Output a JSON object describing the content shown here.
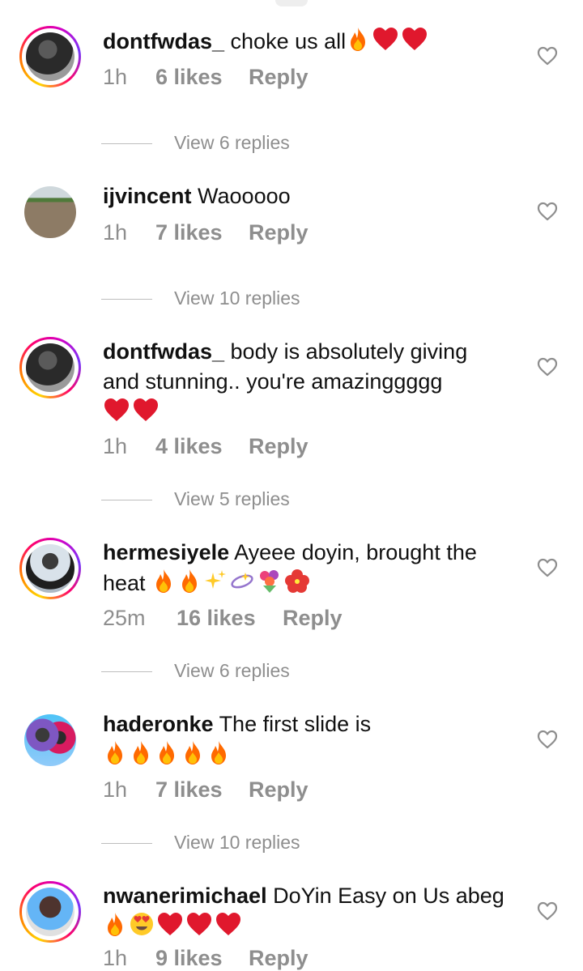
{
  "comments": [
    {
      "username": "dontfwdas_",
      "text": "choke us all",
      "emojis": [
        "fire",
        "heart",
        "heart"
      ],
      "time": "1h",
      "likes": "6 likes",
      "reply": "Reply"
    },
    {
      "username": "ijvincent",
      "text": "Waooooo",
      "emojis": [],
      "time": "1h",
      "likes": "7 likes",
      "reply": "Reply"
    },
    {
      "username": "dontfwdas_",
      "text": "body is absolutely giving and stunning.. you're amazinggggg",
      "emojis": [
        "heart",
        "heart"
      ],
      "time": "1h",
      "likes": "4 likes",
      "reply": "Reply"
    },
    {
      "username": "hermesiyele",
      "text": "Ayeee doyin, brought the heat",
      "emojis": [
        "fire",
        "fire",
        "sparkles",
        "dizzy",
        "bouquet",
        "hibiscus"
      ],
      "time": "25m",
      "likes": "16 likes",
      "reply": "Reply"
    },
    {
      "username": "haderonke",
      "text": "The first slide is",
      "emojis": [
        "fire",
        "fire",
        "fire",
        "fire",
        "fire"
      ],
      "time": "1h",
      "likes": "7 likes",
      "reply": "Reply"
    },
    {
      "username": "nwanerimichael",
      "text": "DoYin Easy on Us abeg",
      "emojis": [
        "fire",
        "heart-eyes",
        "heart",
        "heart",
        "heart"
      ],
      "time": "1h",
      "likes": "9 likes",
      "reply": "Reply"
    }
  ],
  "view_replies": [
    "View 6 replies",
    "View 10 replies",
    "View 5 replies",
    "View 6 replies",
    "View 10 replies"
  ],
  "icons": {
    "like": "heart-outline-icon"
  },
  "colors": {
    "meta_gray": "#8e8e8e",
    "heart_red": "#e0182d",
    "story_ring": "#ff0069"
  }
}
